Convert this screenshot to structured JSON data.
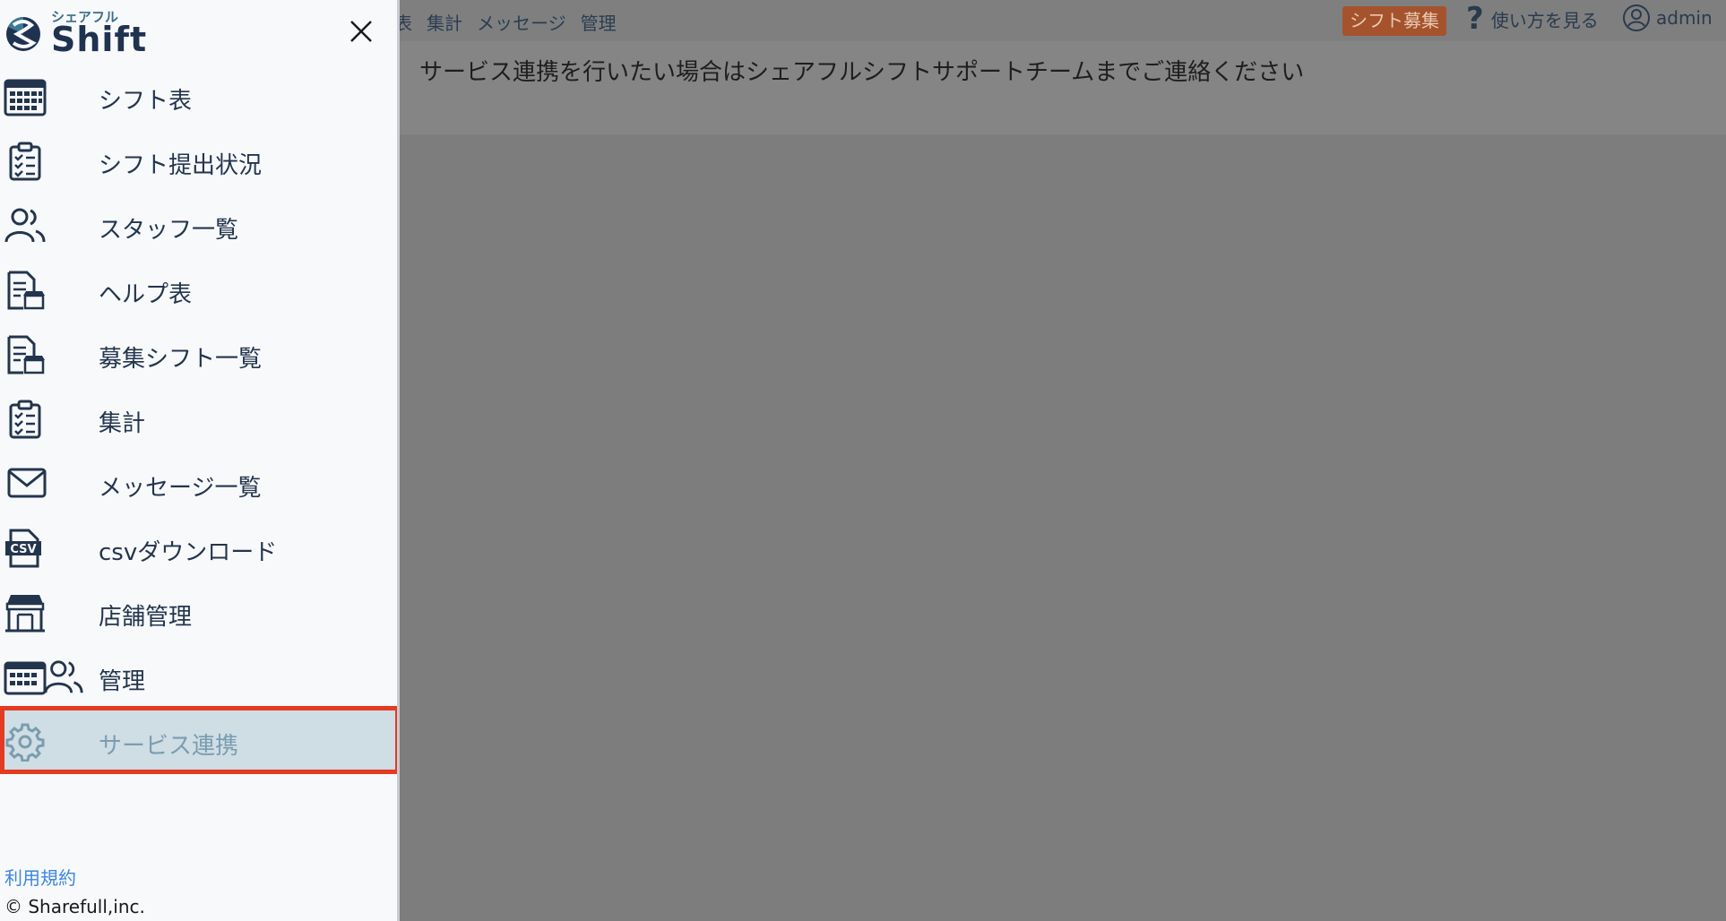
{
  "topbar": {
    "nav": [
      "表",
      "集計",
      "メッセージ",
      "管理"
    ],
    "recruit_button": "シフト募集",
    "help_label": "使い方を見る",
    "user_label": "admin"
  },
  "banner": {
    "message": "サービス連携を行いたい場合はシェアフルシフトサポートチームまでご連絡ください"
  },
  "logo": {
    "small": "シェアフル",
    "big": "Shift"
  },
  "menu": [
    {
      "label": "シフト表",
      "icon": "calendar-grid-icon"
    },
    {
      "label": "シフト提出状況",
      "icon": "clipboard-check-icon"
    },
    {
      "label": "スタッフ一覧",
      "icon": "users-icon"
    },
    {
      "label": "ヘルプ表",
      "icon": "document-store-icon"
    },
    {
      "label": "募集シフト一覧",
      "icon": "document-store-icon"
    },
    {
      "label": "集計",
      "icon": "clipboard-check-icon"
    },
    {
      "label": "メッセージ一覧",
      "icon": "envelope-icon"
    },
    {
      "label": "csvダウンロード",
      "icon": "csv-file-icon"
    },
    {
      "label": "店舗管理",
      "icon": "store-icon"
    },
    {
      "label": "管理",
      "icon": "calendar-users-icon"
    },
    {
      "label": "サービス連携",
      "icon": "gear-icon",
      "active": true
    }
  ],
  "footer": {
    "terms": "利用規約",
    "copyright": "© Sharefull,inc."
  },
  "colors": {
    "accent": "#e23b22",
    "navy": "#23354d",
    "active_bg": "#cfdde4",
    "link": "#3d86e0",
    "recruit": "#a5532c"
  }
}
